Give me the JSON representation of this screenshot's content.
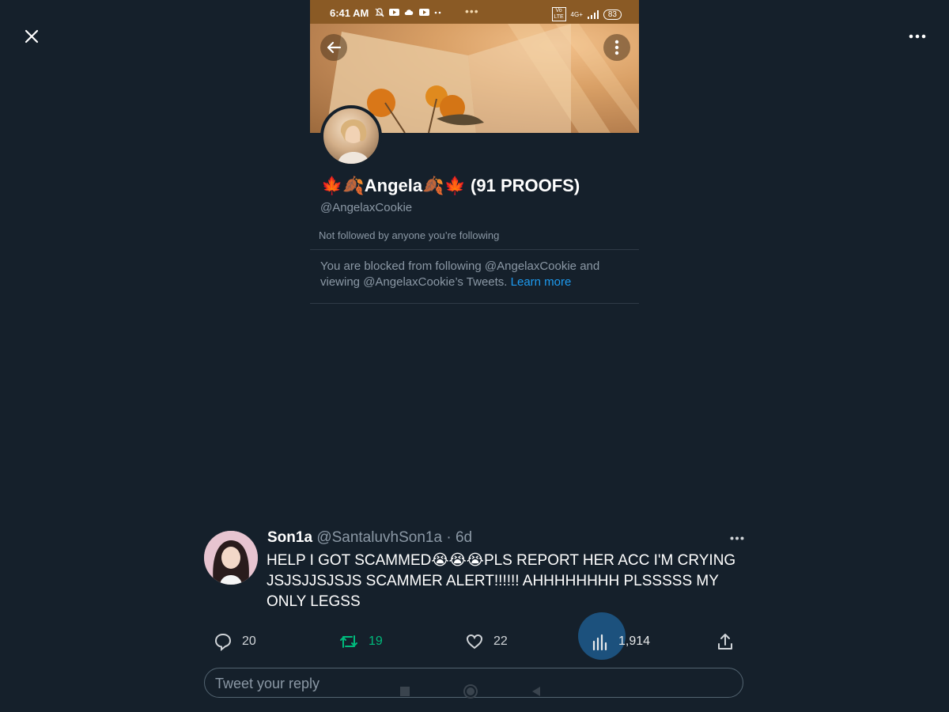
{
  "viewer": {
    "close_icon": "close-icon",
    "more_icon": "more-horizontal-icon"
  },
  "screenshot": {
    "status_bar": {
      "time": "6:41 AM",
      "battery": "83",
      "signal_label": "4G+",
      "volte_label": "Vo LTE"
    },
    "profile": {
      "display_name": "🍁🍂Angela🍂🍁 (91 PROOFS)",
      "handle": "@AngelaxCookie",
      "followers_note": "Not followed by anyone you’re following",
      "blocked_text": "You are blocked from following @AngelaxCookie and viewing @AngelaxCookie’s Tweets.",
      "learn_more": "Learn more"
    }
  },
  "tweet": {
    "name": "Son1a",
    "handle": "@SantaluvhSon1a",
    "time": "· 6d",
    "text": "HELP I GOT SCAMMED😭😭😭PLS REPORT HER ACC I'M CRYING JSJSJJSJSJS SCAMMER ALERT!!!!!! AHHHHHHHH PLSSSSS MY ONLY LEGSS",
    "actions": {
      "replies": "20",
      "retweets": "19",
      "likes": "22",
      "views": "1,914"
    },
    "colors": {
      "retweet": "#00ba7c",
      "link": "#1d9bf0",
      "background": "#15202b"
    }
  },
  "reply": {
    "placeholder": "Tweet your reply"
  }
}
